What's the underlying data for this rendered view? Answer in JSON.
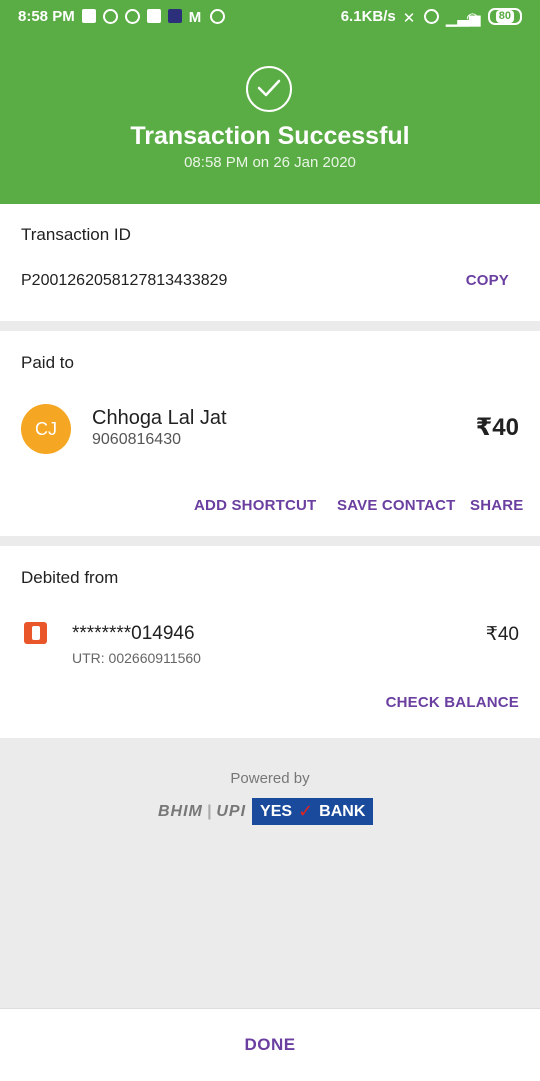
{
  "status_bar": {
    "time": "8:58 PM",
    "network_speed": "6.1KB/s",
    "battery": "80",
    "icons": [
      "message-icon",
      "whatsapp-icon",
      "app-icon",
      "photo-icon",
      "app-icon",
      "gmail-icon",
      "target-icon",
      "mute-icon",
      "alarm-icon",
      "signal-icon",
      "wifi-icon",
      "battery-icon"
    ]
  },
  "header": {
    "title": "Transaction Successful",
    "subtitle": "08:58 PM on 26 Jan 2020",
    "icon": "checkmark-circle-icon"
  },
  "transaction": {
    "label": "Transaction ID",
    "id": "P2001262058127813433829",
    "copy_label": "COPY"
  },
  "paid_to": {
    "label": "Paid to",
    "initials": "CJ",
    "name": "Chhoga Lal Jat",
    "phone": "9060816430",
    "amount": "₹40",
    "actions": {
      "add_shortcut": "ADD SHORTCUT",
      "save_contact": "SAVE CONTACT",
      "share": "SHARE"
    }
  },
  "debited_from": {
    "label": "Debited from",
    "account": "********014946",
    "utr": "UTR: 002660911560",
    "amount": "₹40",
    "check_balance": "CHECK BALANCE",
    "bank_icon": "bank-logo-icon"
  },
  "footer": {
    "powered_by": "Powered by",
    "bhim_text": "BHIM",
    "upi_text": "UPI",
    "yes_text": "YES",
    "bank_text": "BANK",
    "done_label": "DONE"
  },
  "colors": {
    "header_green": "#5aac44",
    "accent_purple": "#6a3fa0",
    "avatar_orange": "#f5a623"
  }
}
